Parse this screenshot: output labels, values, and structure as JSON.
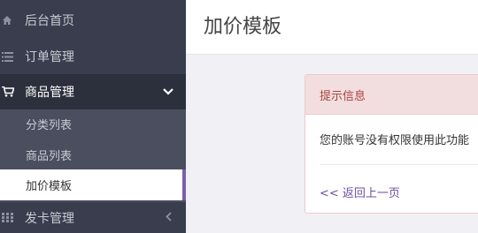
{
  "sidebar": {
    "items": [
      {
        "label": "后台首页",
        "icon": "home-icon"
      },
      {
        "label": "订单管理",
        "icon": "list-icon"
      },
      {
        "label": "商品管理",
        "icon": "cart-icon",
        "expanded": true,
        "children": [
          {
            "label": "分类列表"
          },
          {
            "label": "商品列表"
          },
          {
            "label": "加价模板",
            "active": true
          }
        ]
      },
      {
        "label": "发卡管理",
        "icon": "grid-icon"
      }
    ]
  },
  "header": {
    "title": "加价模板"
  },
  "alert": {
    "title": "提示信息",
    "message": "您的账号没有权限使用此功能",
    "back_link": "<< 返回上一页"
  },
  "colors": {
    "sidebar_bg": "#393d4d",
    "submenu_bg": "#4a4e5e",
    "active_indicator": "#7b5fa8",
    "alert_heading": "#a94442",
    "link": "#6a4fa0"
  }
}
